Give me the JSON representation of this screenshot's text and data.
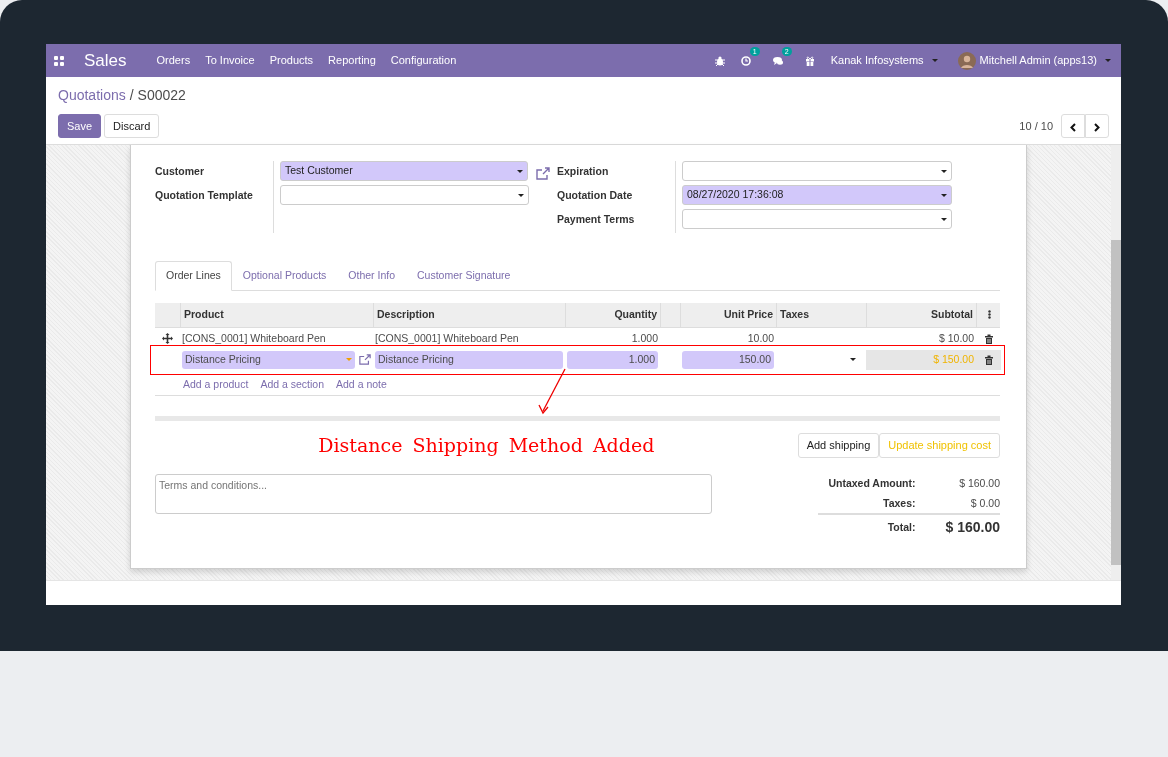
{
  "app": {
    "name": "Sales",
    "menu": [
      "Orders",
      "To Invoice",
      "Products",
      "Reporting",
      "Configuration"
    ],
    "systray": [
      {
        "kind": "debug"
      },
      {
        "kind": "activity",
        "badge": "1"
      },
      {
        "kind": "messages",
        "badge": "2"
      },
      {
        "kind": "gift"
      }
    ],
    "company": "Kanak Infosystems",
    "user": "Mitchell Admin (apps13)"
  },
  "breadcrumb": {
    "parent": "Quotations",
    "separator": "/",
    "current": "S00022"
  },
  "buttons": [
    {
      "label": "Save",
      "kind": "primary"
    },
    {
      "label": "Discard",
      "kind": "default"
    }
  ],
  "pager": "10 / 10",
  "form": {
    "left": [
      {
        "label": "Customer",
        "value": "Test Customer",
        "required": true,
        "link": true
      },
      {
        "label": "Quotation Template",
        "required": false,
        "link": false
      }
    ],
    "right": [
      {
        "label": "Expiration",
        "required": false
      },
      {
        "label": "Quotation Date",
        "value": "08/27/2020 17:36:08",
        "required": true
      },
      {
        "label": "Payment Terms",
        "required": false
      }
    ]
  },
  "tabs": [
    {
      "label": "Order Lines",
      "selected": true
    },
    {
      "label": "Optional Products",
      "selected": false
    },
    {
      "label": "Other Info",
      "selected": false
    },
    {
      "label": "Customer Signature",
      "selected": false
    }
  ],
  "table": {
    "columns": [
      "Product",
      "Description",
      "Quantity",
      "Unit Price",
      "Taxes",
      "Subtotal"
    ],
    "rows": [
      {
        "kind": "line",
        "annotated": false,
        "product": "[CONS_0001] Whiteboard Pen",
        "description": "[CONS_0001] Whiteboard Pen",
        "quantity": "1.000",
        "unit_price": "10.00",
        "subtotal": "$ 10.00"
      },
      {
        "kind": "editing",
        "annotated": true,
        "product": "Distance Pricing",
        "description": "Distance Pricing",
        "quantity": "1.000",
        "unit_price": "150.00",
        "subtotal": "$ 150.00"
      }
    ],
    "add_links": [
      "Add a product",
      "Add a section",
      "Add a note"
    ]
  },
  "annotation": {
    "text": "Distance Shipping Method Added"
  },
  "shipping_buttons": [
    {
      "label": "Add shipping",
      "kind": "default"
    },
    {
      "label": "Update shipping cost",
      "kind": "warning"
    }
  ],
  "terms": {
    "placeholder": "Terms and conditions..."
  },
  "totals": [
    {
      "label": "Untaxed Amount:",
      "value": "$ 160.00",
      "kind": "normal"
    },
    {
      "label": "Taxes:",
      "value": "$ 0.00",
      "kind": "normal"
    },
    {
      "label": "Total:",
      "value": "$ 160.00",
      "kind": "grand"
    }
  ]
}
